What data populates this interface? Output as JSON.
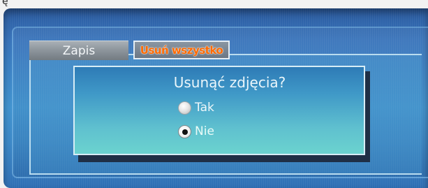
{
  "top_mark": "ę",
  "tabs": [
    {
      "label": "Zapis",
      "selected": false
    },
    {
      "label": "Usuń wszystko",
      "selected": true
    }
  ],
  "dialog": {
    "title": "Usunąć zdjęcia?",
    "options": [
      {
        "label": "Tak",
        "selected": false
      },
      {
        "label": "Nie",
        "selected": true
      }
    ]
  },
  "colors": {
    "screen_blue": "#3a82c5",
    "dialog_top": "#2e7bb6",
    "dialog_bottom": "#6bd3cf",
    "active_tab_text": "#ff6a00"
  }
}
